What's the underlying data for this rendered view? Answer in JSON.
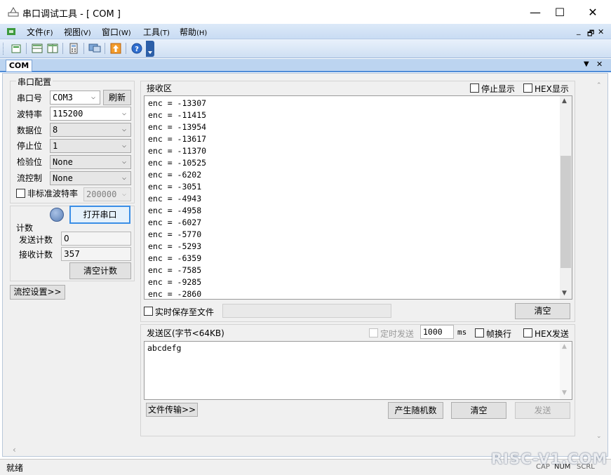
{
  "window": {
    "title": "串口调试工具 - [ COM ]",
    "min_glyph": "—",
    "max_glyph": "☐",
    "close_glyph": "✕"
  },
  "menu": [
    {
      "label": "文件",
      "key": "(F)"
    },
    {
      "label": "视图",
      "key": "(V)"
    },
    {
      "label": "窗口",
      "key": "(W)"
    },
    {
      "label": "工具",
      "key": "(T)"
    },
    {
      "label": "帮助",
      "key": "(H)"
    }
  ],
  "mdi": {
    "min": "_",
    "restore": "🗗",
    "close": "✕"
  },
  "toolbar_icons": [
    "new-icon",
    "split-horizontal-icon",
    "split-vertical-icon",
    "calculator-icon",
    "monitor-icon",
    "upload-icon",
    "help-icon"
  ],
  "tab": {
    "label": "COM",
    "menu_glyph": "▼",
    "close_glyph": "✕"
  },
  "serial_config": {
    "title": "串口配置",
    "port_label": "串口号",
    "port_value": "COM3",
    "refresh_label": "刷新",
    "baud_label": "波特率",
    "baud_value": "115200",
    "databits_label": "数据位",
    "databits_value": "8",
    "stopbits_label": "停止位",
    "stopbits_value": "1",
    "parity_label": "检验位",
    "parity_value": "None",
    "flow_label": "流控制",
    "flow_value": "None",
    "nonstd_label": "非标准波特率",
    "nonstd_value": "200000"
  },
  "open_port_label": "打开串口",
  "counter": {
    "title": "计数",
    "send_label": "发送计数",
    "send_value": "0",
    "recv_label": "接收计数",
    "recv_value": "357",
    "clear_label": "清空计数"
  },
  "flow_settings_label": "流控设置>>",
  "receive": {
    "title": "接收区",
    "stop_display_label": "停止显示",
    "hex_display_label": "HEX显示",
    "lines": [
      "enc = -13307",
      "enc = -11415",
      "enc = -13954",
      "enc = -13617",
      "enc = -11370",
      "enc = -10525",
      "enc = -6202",
      "enc = -3051",
      "enc = -4943",
      "enc = -4958",
      "enc = -6027",
      "enc = -5770",
      "enc = -5293",
      "enc = -6359",
      "enc = -7585",
      "enc = -9285",
      "enc = -2860"
    ],
    "save_to_file_label": "实时保存至文件",
    "clear_label": "清空"
  },
  "send": {
    "title": "发送区(字节<64KB)",
    "timed_label": "定时发送",
    "interval_value": "1000",
    "interval_unit": "ms",
    "newline_label": "帧换行",
    "hex_send_label": "HEX发送",
    "content": "abcdefg",
    "file_transfer_label": "文件传输>>",
    "random_label": "产生随机数",
    "clear_label": "清空",
    "send_label": "发送"
  },
  "status": {
    "text": "就绪",
    "cap": "CAP",
    "num": "NUM",
    "scrl": "SCRL"
  },
  "watermark": "RISC-V1.COM"
}
